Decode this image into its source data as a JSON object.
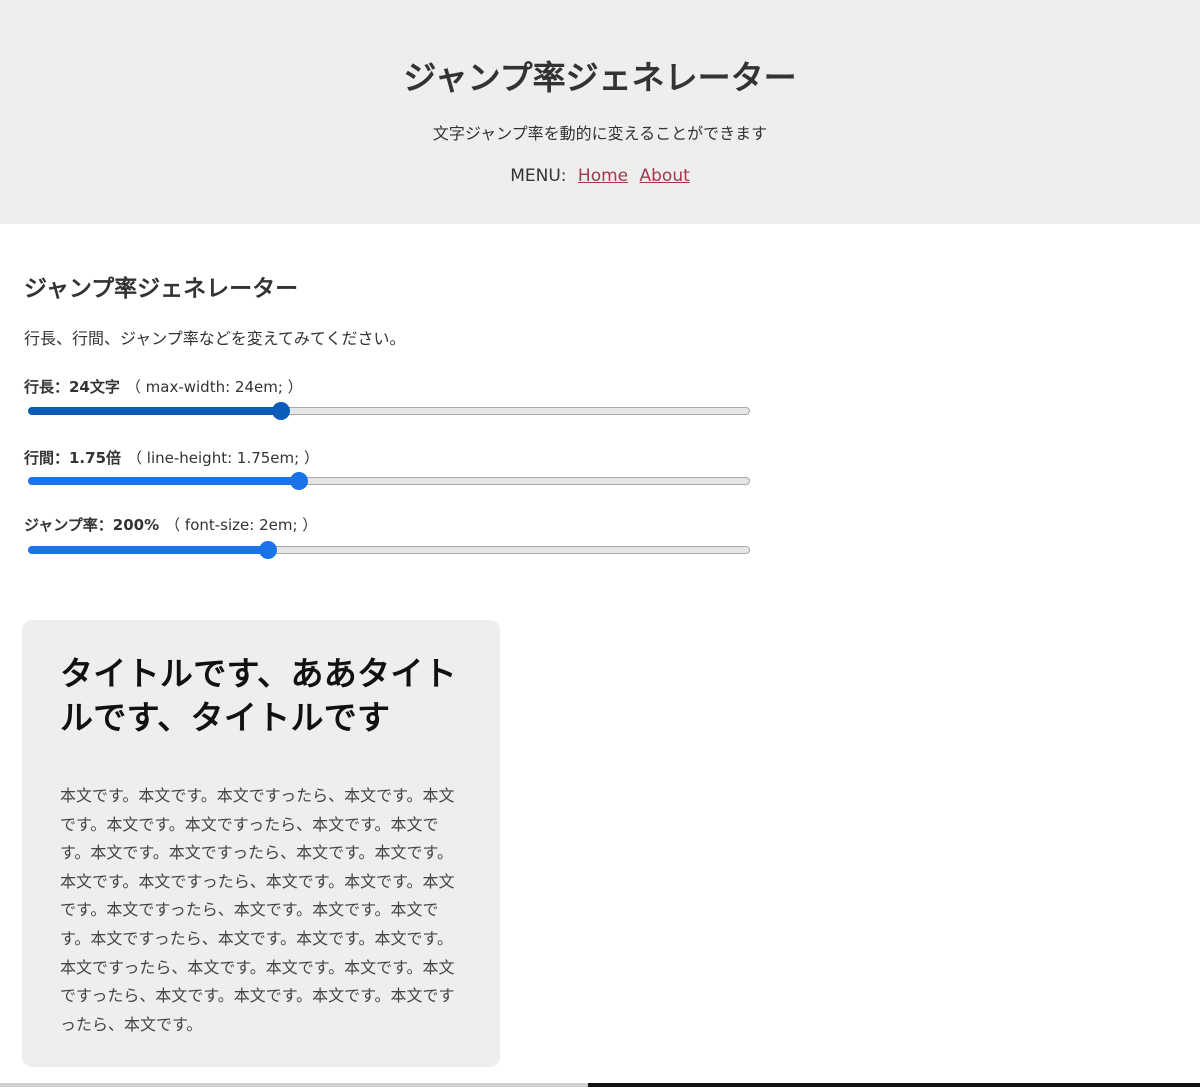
{
  "header": {
    "title": "ジャンプ率ジェネレーター",
    "description": "文字ジャンプ率を動的に変えることができます",
    "menu_label": "MENU:",
    "menu_items": [
      "Home",
      "About"
    ]
  },
  "main": {
    "title": "ジャンプ率ジェネレーター",
    "intro": "行長、行間、ジャンプ率などを変えてみてください。",
    "controls": [
      {
        "label": "行長：24文字",
        "code": "（ max-width: 24em; ）",
        "value_fraction": 0.35,
        "color": "#0b5cb8"
      },
      {
        "label": "行間：1.75倍",
        "code": "（ line-height: 1.75em; ）",
        "value_fraction": 0.375,
        "color": "#1a73e8"
      },
      {
        "label": "ジャンプ率：200%",
        "code": "（ font-size: 2em; ）",
        "value_fraction": 0.333,
        "color": "#1a73e8"
      }
    ]
  },
  "preview": {
    "title": "タイトルです、ああタイトルです、タイトルです",
    "body": "本文です。本文です。本文ですったら、本文です。本文です。本文です。本文ですったら、本文です。本文です。本文です。本文ですったら、本文です。本文です。本文です。本文ですったら、本文です。本文です。本文です。本文ですったら、本文です。本文です。本文です。本文ですったら、本文です。本文です。本文です。本文ですったら、本文です。本文です。本文です。本文ですったら、本文です。本文です。本文です。本文ですったら、本文です。"
  }
}
